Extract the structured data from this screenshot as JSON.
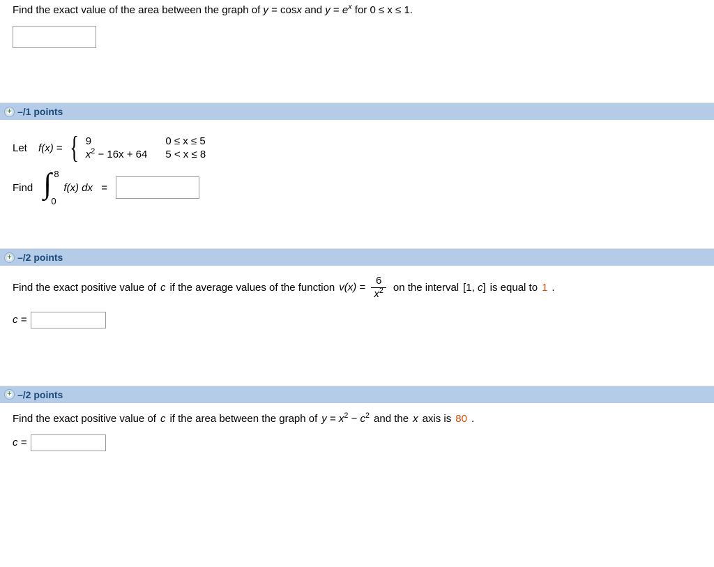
{
  "top_question": {
    "prompt_prefix": "Find the exact value of the area between the graph of ",
    "eq1_lhs": "y",
    "eq1_rhs": "cos",
    "eq1_arg": "x",
    "and_word": " and ",
    "eq2_lhs": "y",
    "eq2_rhs_base": "e",
    "eq2_exp": "x",
    "for_word": " for ",
    "range": "0 ≤ x ≤ 1.",
    "answer": ""
  },
  "q1": {
    "points": "–/1 points",
    "let_label": "Let",
    "func_name": "f(x)",
    "cases": {
      "r1_left": "9",
      "r1_right": "0 ≤ x ≤ 5",
      "r2_left_a": "x",
      "r2_left_exp": "2",
      "r2_left_b": " − 16x + 64",
      "r2_right": "5 < x ≤ 8"
    },
    "find_label": "Find",
    "int_upper": "8",
    "int_lower": "0",
    "integrand": "f(x) dx",
    "answer": ""
  },
  "q2": {
    "points": "–/2 points",
    "prompt_a": "Find the exact positive value of ",
    "c_var": "c",
    "prompt_b": " if the average values of the function ",
    "vfunc": "v(x)",
    "frac_num": "6",
    "frac_den_base": "x",
    "frac_den_exp": "2",
    "prompt_c": " on the interval ",
    "interval_open": "[1, ",
    "interval_var": "c",
    "interval_close": "]",
    "prompt_d": " is equal to ",
    "target": "1",
    "period": ".",
    "answer_label": "c =",
    "answer": ""
  },
  "q3": {
    "points": "–/2 points",
    "prompt_a": "Find the exact positive value of ",
    "c_var": "c",
    "prompt_b": " if the area between the graph of ",
    "eq_lhs": "y",
    "eq_a": "x",
    "eq_a_exp": "2",
    "eq_mid": " − ",
    "eq_b": "c",
    "eq_b_exp": "2",
    "prompt_c": " and the ",
    "axis_var": "x",
    "axis_word": " axis is ",
    "target": "80",
    "period": ".",
    "answer_label": "c =",
    "answer": ""
  }
}
